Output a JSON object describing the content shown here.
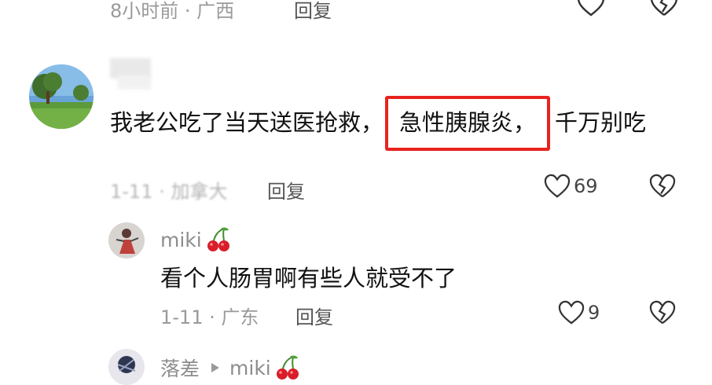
{
  "top_comment": {
    "meta": "8小时前 · 广西",
    "reply": "回复"
  },
  "main_comment": {
    "text_before": "我老公吃了当天送医抢救，",
    "text_highlight": "急性胰腺炎，",
    "text_after": "千万别吃",
    "meta": "1-11 · 加拿大",
    "reply": "回复",
    "likes": "69"
  },
  "reply_1": {
    "username": "miki",
    "text": "看个人肠胃啊有些人就受不了",
    "meta": "1-11 · 广东",
    "reply": "回复",
    "likes": "9"
  },
  "reply_2": {
    "username": "落差",
    "reply_to": "miki"
  },
  "colors": {
    "highlight_border": "#e8231f",
    "meta_gray": "#9a9a9a"
  }
}
